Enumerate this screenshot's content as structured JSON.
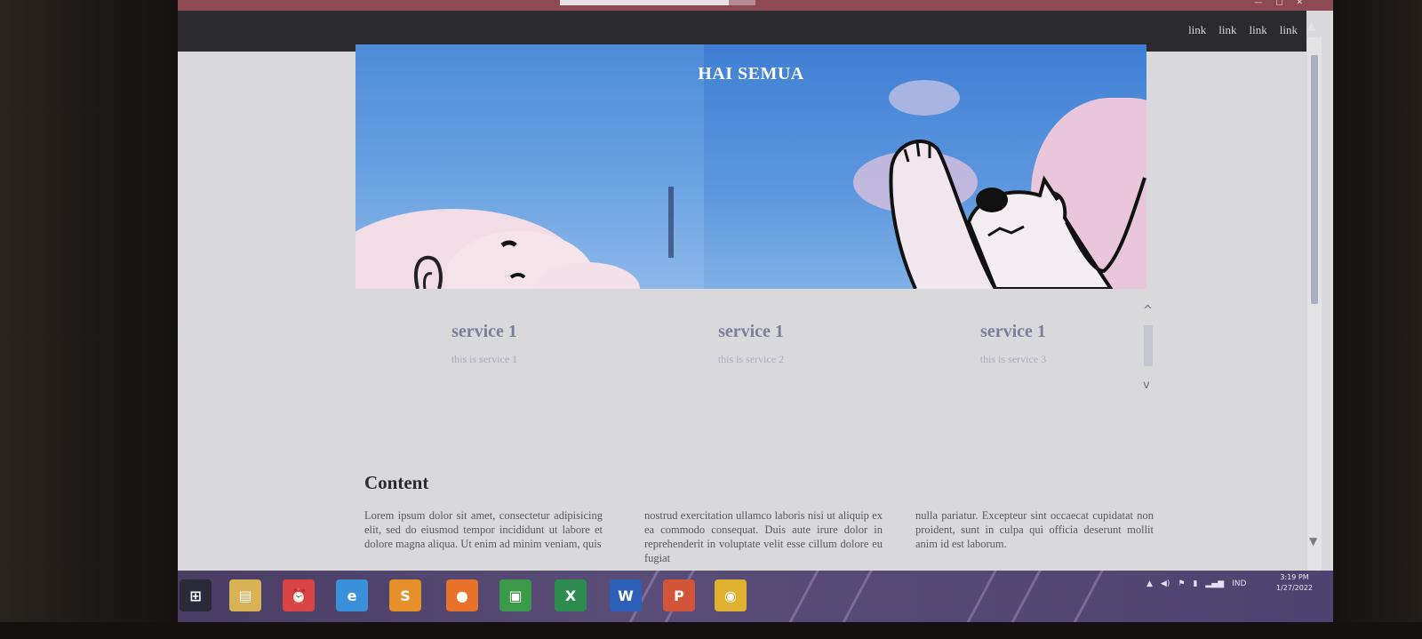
{
  "navbar": {
    "links": [
      "link",
      "link",
      "link",
      "link"
    ]
  },
  "hero": {
    "title": "HAI SEMUA"
  },
  "services": [
    {
      "title": "service 1",
      "desc": "this is service 1"
    },
    {
      "title": "service 1",
      "desc": "this is service 2"
    },
    {
      "title": "service 1",
      "desc": "this is service 3"
    }
  ],
  "content": {
    "heading": "Content",
    "columns": [
      "Lorem ipsum dolor sit amet, consectetur adipisicing elit, sed do eiusmod tempor incididunt ut labore et dolore magna aliqua. Ut enim ad minim veniam, quis",
      "nostrud exercitation ullamco laboris nisi ut aliquip ex ea commodo consequat. Duis aute irure dolor in reprehenderit in voluptate velit esse cillum dolore eu fugiat",
      "nulla pariatur. Excepteur sint occaecat cupidatat non proident, sunt in culpa qui officia deserunt mollit anim id est laborum."
    ]
  },
  "taskbar": {
    "apps": [
      {
        "name": "start-button",
        "glyph": "⊞",
        "color": "#2a2a3a"
      },
      {
        "name": "file-explorer",
        "glyph": "▤",
        "color": "#d9b255"
      },
      {
        "name": "alarm-app",
        "glyph": "⏰",
        "color": "#d94545"
      },
      {
        "name": "internet-explorer",
        "glyph": "e",
        "color": "#3a8fd9"
      },
      {
        "name": "sublime-text",
        "glyph": "S",
        "color": "#e58f2a"
      },
      {
        "name": "firefox",
        "glyph": "●",
        "color": "#e8722a"
      },
      {
        "name": "store",
        "glyph": "▣",
        "color": "#3a9a4a"
      },
      {
        "name": "excel",
        "glyph": "X",
        "color": "#2e8b4f"
      },
      {
        "name": "word",
        "glyph": "W",
        "color": "#2b5fb8"
      },
      {
        "name": "powerpoint",
        "glyph": "P",
        "color": "#d2553a"
      },
      {
        "name": "chrome",
        "glyph": "◉",
        "color": "#e0b030"
      }
    ],
    "tray_lang": "IND",
    "clock_time": "3:19 PM",
    "clock_date": "1/27/2022"
  }
}
